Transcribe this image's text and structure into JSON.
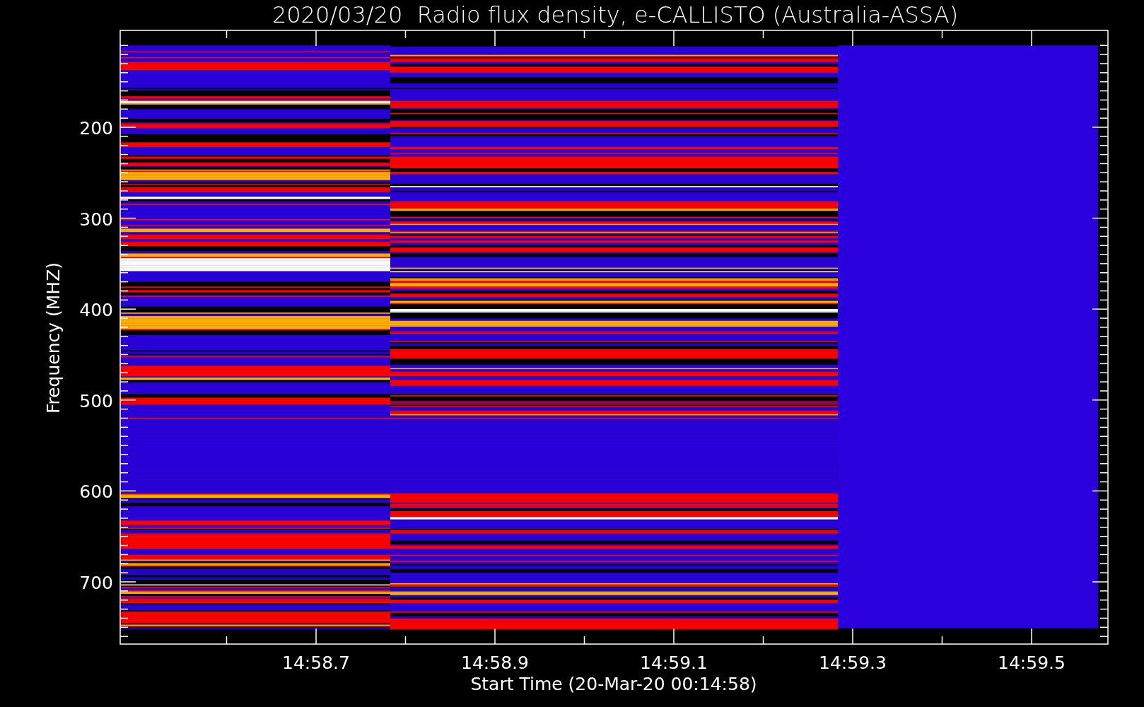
{
  "title": "2020/03/20  Radio flux density, e-CALLISTO (Australia-ASSA)",
  "y_axis": {
    "label": "Frequency (MHZ)",
    "ticks": [
      "200",
      "300",
      "400",
      "500",
      "600",
      "700"
    ]
  },
  "x_axis": {
    "label": "Start Time (20-Mar-20 00:14:58)",
    "ticks": [
      "14:58.7",
      "14:58.9",
      "14:59.1",
      "14:59.3",
      "14:59.5"
    ]
  }
}
